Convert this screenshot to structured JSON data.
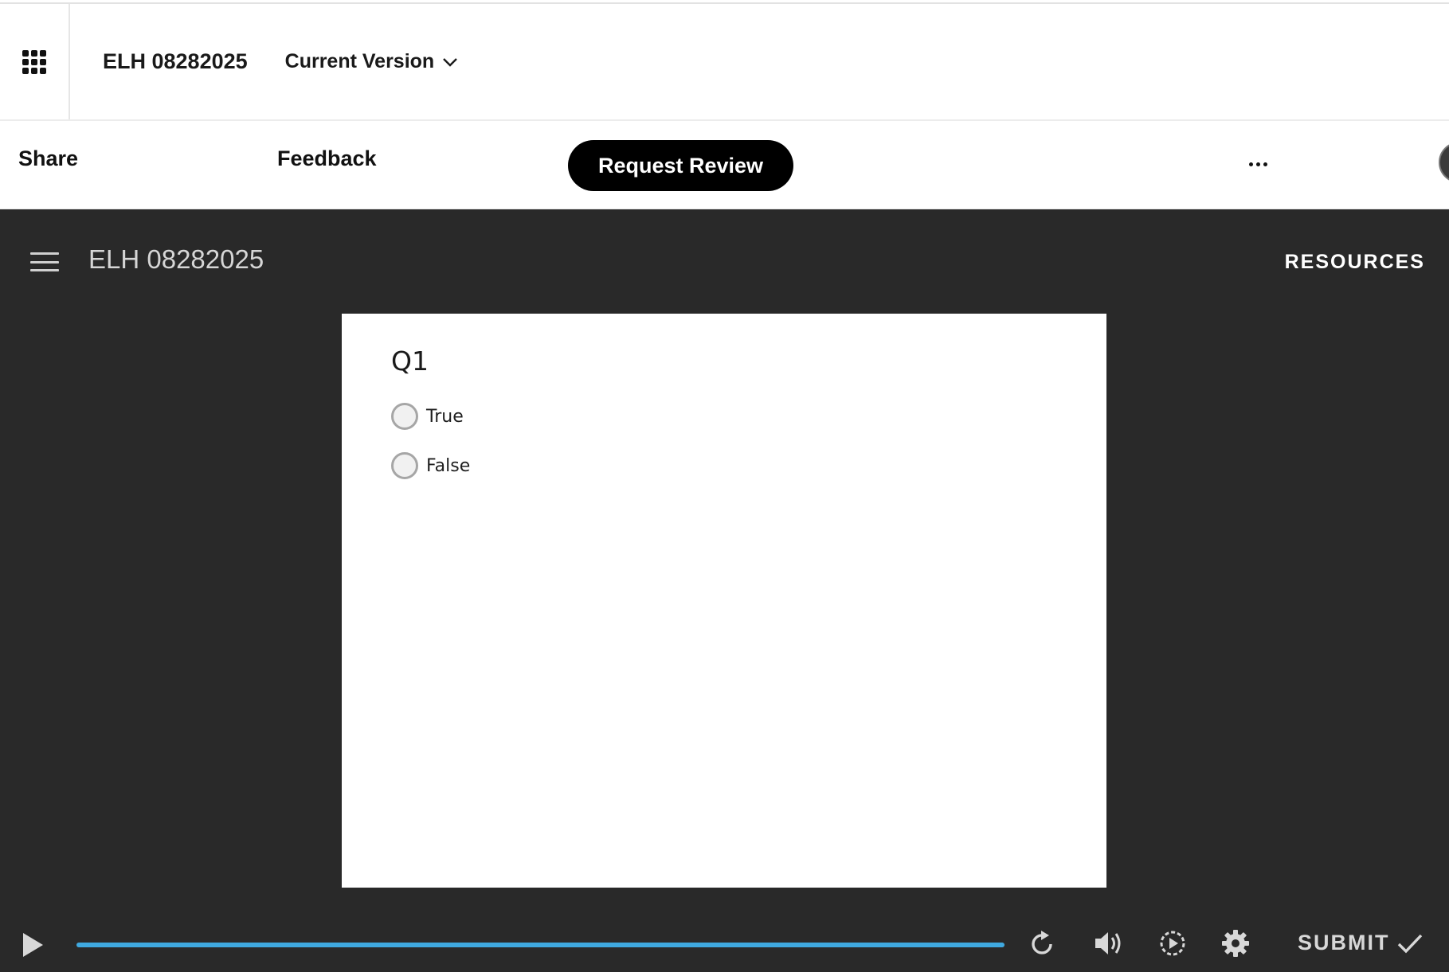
{
  "header": {
    "project_title": "ELH 08282025",
    "version_label": "Current Version"
  },
  "actions": {
    "share": "Share",
    "feedback": "Feedback",
    "request_review": "Request Review"
  },
  "player": {
    "course_title": "ELH 08282025",
    "resources_label": "RESOURCES",
    "question": {
      "title": "Q1",
      "options": [
        "True",
        "False"
      ]
    },
    "progress_percent": 100,
    "submit_label": "SUBMIT"
  },
  "colors": {
    "player_bg": "#292929",
    "progress": "#3fa9e0",
    "button_primary": "#000000"
  },
  "icons": [
    "apps-grid-icon",
    "chevron-down-icon",
    "more-icon",
    "menu-icon",
    "play-icon",
    "replay-icon",
    "volume-icon",
    "playback-speed-icon",
    "gear-icon",
    "check-icon"
  ]
}
